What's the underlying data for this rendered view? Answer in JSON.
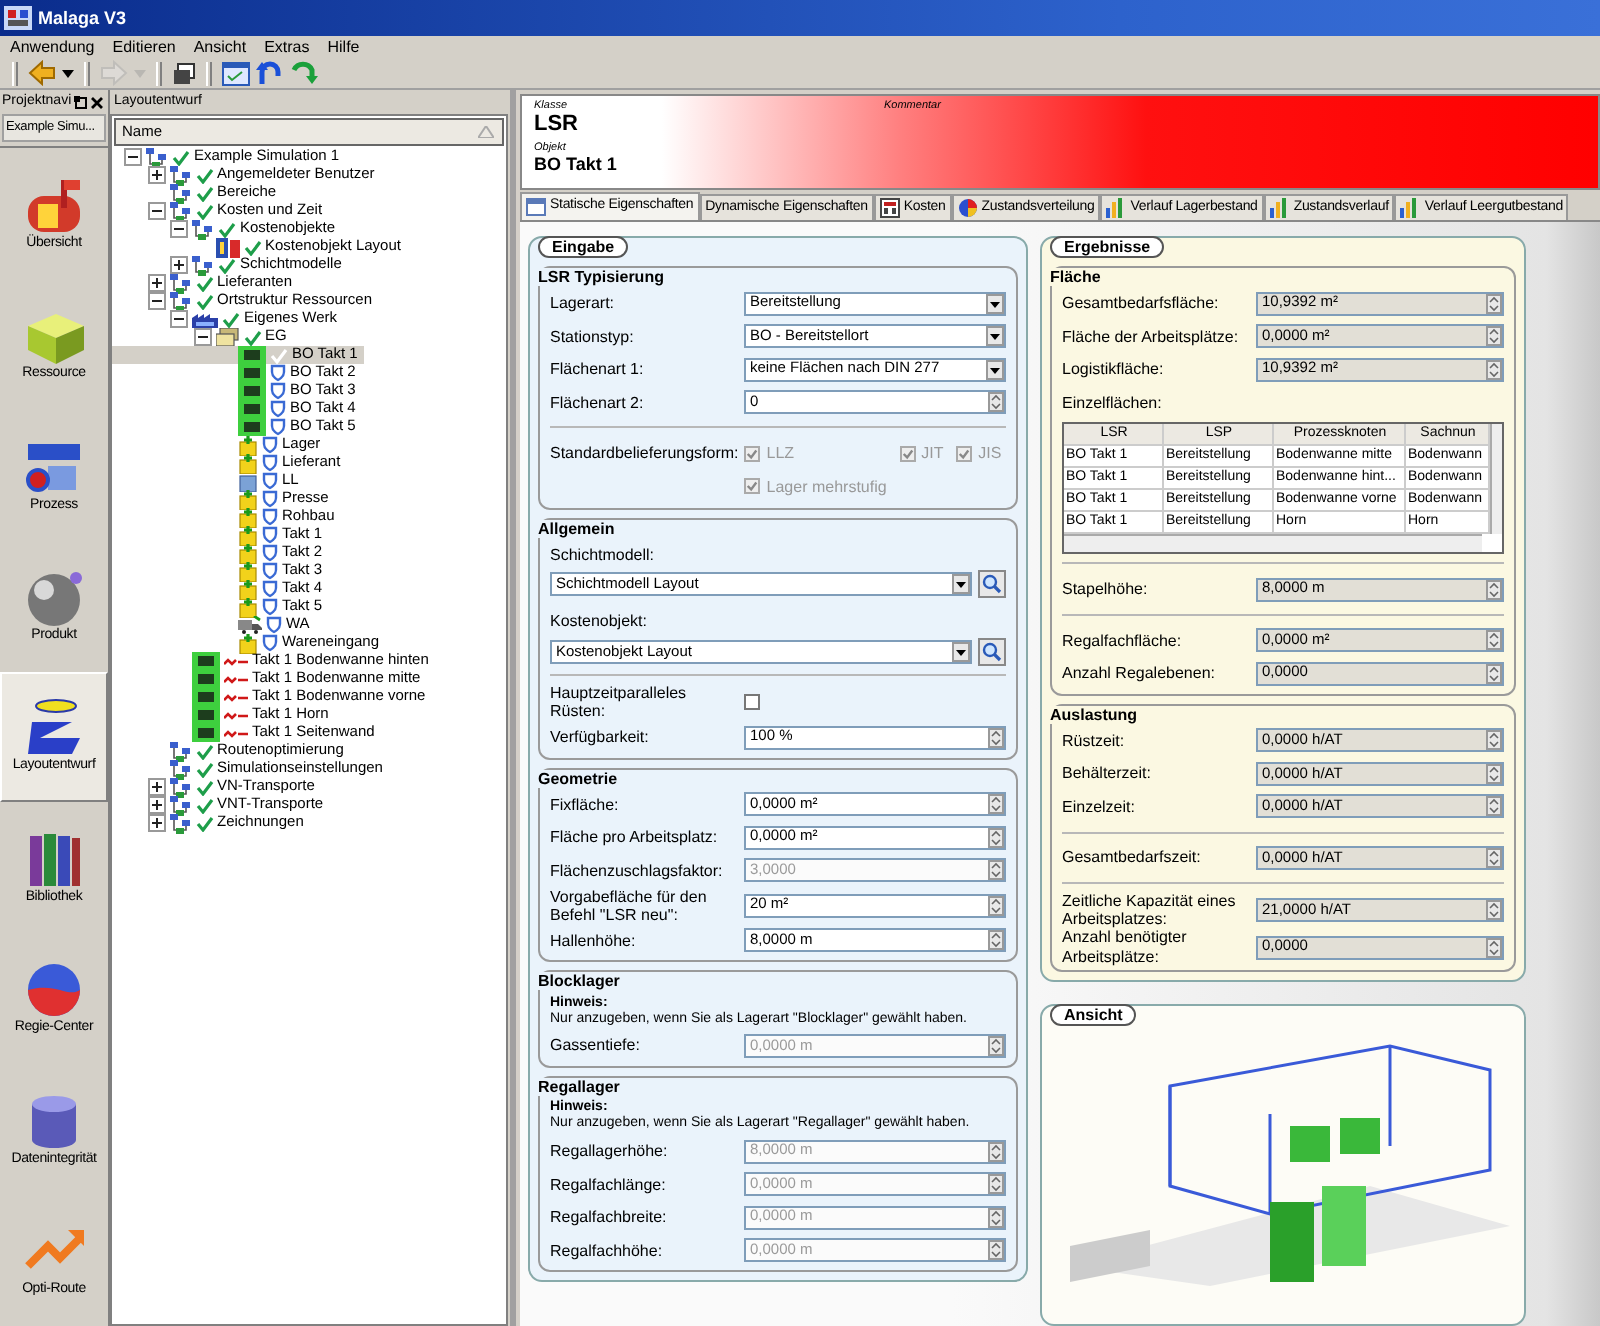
{
  "window": {
    "title": "Malaga V3"
  },
  "menu": [
    "Anwendung",
    "Editieren",
    "Ansicht",
    "Extras",
    "Hilfe"
  ],
  "toolbar": [
    {
      "kind": "back",
      "disabled": false
    },
    {
      "kind": "caret",
      "disabled": false
    },
    {
      "kind": "forward",
      "disabled": true
    },
    {
      "kind": "caret",
      "disabled": true
    },
    {
      "kind": "restore",
      "disabled": false
    },
    {
      "kind": "window",
      "disabled": false
    },
    {
      "kind": "undo",
      "disabled": false
    },
    {
      "kind": "redo",
      "disabled": false
    }
  ],
  "navigator": {
    "title": "Projektnavi",
    "project": "Example Simu...",
    "items": [
      {
        "label": "Übersicht",
        "kind": "mailbox",
        "selected": false
      },
      {
        "label": "Ressource",
        "kind": "cube",
        "selected": false
      },
      {
        "label": "Prozess",
        "kind": "process",
        "selected": false
      },
      {
        "label": "Produkt",
        "kind": "sphere",
        "selected": false
      },
      {
        "label": "Layoutentwurf",
        "kind": "layout",
        "selected": true
      },
      {
        "label": "Bibliothek",
        "kind": "books",
        "selected": false
      },
      {
        "label": "Regie-Center",
        "kind": "disc",
        "selected": false
      },
      {
        "label": "Datenintegrität",
        "kind": "cylinder",
        "selected": false
      },
      {
        "label": "Opti-Route",
        "kind": "route",
        "selected": false
      }
    ]
  },
  "tree": {
    "title": "Layoutentwurf",
    "column": "Name",
    "nodes": [
      {
        "label": "Example Simulation 1",
        "kind": "group",
        "checked": true,
        "error": false,
        "expanded": true,
        "selected": false,
        "children": [
          {
            "label": "Angemeldeter Benutzer",
            "kind": "group",
            "checked": true,
            "error": false,
            "expanded": false,
            "selected": false
          },
          {
            "label": "Bereiche",
            "kind": "group",
            "checked": true,
            "error": false,
            "selected": false
          },
          {
            "label": "Kosten und Zeit",
            "kind": "group",
            "checked": true,
            "error": false,
            "expanded": true,
            "selected": false,
            "children": [
              {
                "label": "Kostenobjekte",
                "kind": "group",
                "checked": true,
                "error": false,
                "expanded": true,
                "selected": false,
                "children": [
                  {
                    "label": "Kostenobjekt Layout",
                    "kind": "cost",
                    "checked": true,
                    "error": false,
                    "selected": false
                  }
                ]
              },
              {
                "label": "Schichtmodelle",
                "kind": "group",
                "checked": true,
                "error": false,
                "expanded": false,
                "selected": false
              }
            ]
          },
          {
            "label": "Lieferanten",
            "kind": "group",
            "checked": true,
            "error": false,
            "expanded": false,
            "selected": false
          },
          {
            "label": "Ortstruktur Ressourcen",
            "kind": "group",
            "checked": true,
            "error": false,
            "expanded": true,
            "selected": false,
            "children": [
              {
                "label": "Eigenes Werk",
                "kind": "plant",
                "checked": true,
                "error": false,
                "expanded": true,
                "selected": false,
                "children": [
                  {
                    "label": "EG",
                    "kind": "floor",
                    "checked": true,
                    "error": false,
                    "expanded": true,
                    "selected": false,
                    "children": [
                      {
                        "label": "BO Takt 1",
                        "kind": "station",
                        "checked": true,
                        "error": false,
                        "selected": true
                      },
                      {
                        "label": "BO Takt 2",
                        "kind": "station",
                        "checked": false,
                        "error": false,
                        "selected": false
                      },
                      {
                        "label": "BO Takt 3",
                        "kind": "station",
                        "checked": false,
                        "error": false,
                        "selected": false
                      },
                      {
                        "label": "BO Takt 4",
                        "kind": "station",
                        "checked": false,
                        "error": false,
                        "selected": false
                      },
                      {
                        "label": "BO Takt 5",
                        "kind": "station",
                        "checked": false,
                        "error": false,
                        "selected": false
                      },
                      {
                        "label": "Lager",
                        "kind": "storage",
                        "checked": false,
                        "error": false,
                        "selected": false
                      },
                      {
                        "label": "Lieferant",
                        "kind": "storage",
                        "checked": false,
                        "error": false,
                        "selected": false
                      },
                      {
                        "label": "LL",
                        "kind": "block",
                        "checked": false,
                        "error": false,
                        "selected": false
                      },
                      {
                        "label": "Presse",
                        "kind": "storage",
                        "checked": false,
                        "error": false,
                        "selected": false
                      },
                      {
                        "label": "Rohbau",
                        "kind": "storage",
                        "checked": false,
                        "error": false,
                        "selected": false
                      },
                      {
                        "label": "Takt 1",
                        "kind": "storage",
                        "checked": false,
                        "error": false,
                        "selected": false
                      },
                      {
                        "label": "Takt 2",
                        "kind": "storage",
                        "checked": false,
                        "error": false,
                        "selected": false
                      },
                      {
                        "label": "Takt 3",
                        "kind": "storage",
                        "checked": false,
                        "error": false,
                        "selected": false
                      },
                      {
                        "label": "Takt 4",
                        "kind": "storage",
                        "checked": false,
                        "error": false,
                        "selected": false
                      },
                      {
                        "label": "Takt 5",
                        "kind": "storage",
                        "checked": false,
                        "error": false,
                        "selected": false
                      },
                      {
                        "label": "WA",
                        "kind": "truck",
                        "checked": false,
                        "error": false,
                        "selected": false
                      },
                      {
                        "label": "Wareneingang",
                        "kind": "storage",
                        "checked": false,
                        "error": false,
                        "selected": false
                      }
                    ]
                  }
                ]
              },
              {
                "label": "Takt 1 Bodenwanne hinten",
                "kind": "station",
                "error": true,
                "selected": false
              },
              {
                "label": "Takt 1 Bodenwanne mitte",
                "kind": "station",
                "error": true,
                "selected": false
              },
              {
                "label": "Takt 1 Bodenwanne vorne",
                "kind": "station",
                "error": true,
                "selected": false
              },
              {
                "label": "Takt 1 Horn",
                "kind": "station",
                "error": true,
                "selected": false
              },
              {
                "label": "Takt 1 Seitenwand",
                "kind": "station",
                "error": true,
                "selected": false
              }
            ]
          },
          {
            "label": "Routenoptimierung",
            "kind": "group",
            "checked": true,
            "error": false,
            "selected": false
          },
          {
            "label": "Simulationseinstellungen",
            "kind": "group",
            "checked": true,
            "error": false,
            "selected": false
          },
          {
            "label": "VN-Transporte",
            "kind": "group",
            "checked": true,
            "error": false,
            "expanded": false,
            "selected": false
          },
          {
            "label": "VNT-Transporte",
            "kind": "group",
            "checked": true,
            "error": false,
            "expanded": false,
            "selected": false
          },
          {
            "label": "Zeichnungen",
            "kind": "group",
            "checked": true,
            "error": false,
            "expanded": false,
            "selected": false
          }
        ]
      }
    ]
  },
  "detail": {
    "class_label": "Klasse",
    "class": "LSR",
    "object_label": "Objekt",
    "object": "BO Takt 1",
    "comment_label": "Kommentar",
    "tabs": [
      {
        "label": "Statische Eigenschaften",
        "kind": "window",
        "selected": true
      },
      {
        "label": "Dynamische Eigenschaften",
        "kind": "plain",
        "selected": false
      },
      {
        "label": "Kosten",
        "kind": "calculator",
        "selected": false
      },
      {
        "label": "Zustandsverteilung",
        "kind": "pie",
        "selected": false
      },
      {
        "label": "Verlauf Lagerbestand",
        "kind": "bars",
        "selected": false
      },
      {
        "label": "Zustandsverlauf",
        "kind": "bars",
        "selected": false
      },
      {
        "label": "Verlauf Leergutbestand",
        "kind": "bars",
        "selected": false
      }
    ],
    "input": {
      "title": "Eingabe",
      "sections": [
        {
          "title": "LSR Typisierung",
          "rows": [
            {
              "kind": "select",
              "label": "Lagerart:",
              "value": "Bereitstellung",
              "disabled": false
            },
            {
              "kind": "select",
              "label": "Stationstyp:",
              "value": "BO - Bereitstellort",
              "disabled": false
            },
            {
              "kind": "select",
              "label": "Flächenart 1:",
              "value": "keine Flächen nach DIN 277",
              "disabled": false
            },
            {
              "kind": "spin",
              "label": "Flächenart 2:",
              "value": "0",
              "disabled": false
            },
            {
              "kind": "separator"
            },
            {
              "kind": "checks",
              "label": "Standardbelieferungsform:",
              "options": [
                {
                  "label": "LLZ",
                  "checked": true,
                  "disabled": true
                },
                {
                  "label": "JIT",
                  "checked": true,
                  "disabled": true
                },
                {
                  "label": "JIS",
                  "checked": true,
                  "disabled": true
                },
                {
                  "label": "Lager mehrstufig",
                  "checked": true,
                  "disabled": true
                }
              ]
            }
          ]
        },
        {
          "title": "Allgemein",
          "rows": [
            {
              "kind": "wide-select",
              "label": "Schichtmodell:",
              "value": "Schichtmodell Layout",
              "disabled": false
            },
            {
              "kind": "wide-select",
              "label": "Kostenobjekt:",
              "value": "Kostenobjekt Layout",
              "disabled": false
            },
            {
              "kind": "separator"
            },
            {
              "kind": "check",
              "label": "Hauptzeitparalleles Rüsten:",
              "checked": false,
              "disabled": false
            },
            {
              "kind": "spin",
              "label": "Verfügbarkeit:",
              "value": "100 %",
              "disabled": false
            }
          ]
        },
        {
          "title": "Geometrie",
          "rows": [
            {
              "kind": "spin",
              "label": "Fixfläche:",
              "value": "0,0000 m²",
              "disabled": false
            },
            {
              "kind": "spin",
              "label": "Fläche pro Arbeitsplatz:",
              "value": "0,0000 m²",
              "disabled": false
            },
            {
              "kind": "spin",
              "label": "Flächenzuschlagsfaktor:",
              "value": "3,0000",
              "disabled": true
            },
            {
              "kind": "spin",
              "label": "Vorgabefläche für den Befehl \"LSR neu\":",
              "value": "20 m²",
              "disabled": false
            },
            {
              "kind": "spin",
              "label": "Hallenhöhe:",
              "value": "8,0000 m",
              "disabled": false
            }
          ]
        },
        {
          "title": "Blocklager",
          "rows": [
            {
              "kind": "note",
              "title": "Hinweis:",
              "text": "Nur anzugeben, wenn Sie als Lagerart \"Blocklager\" gewählt haben."
            },
            {
              "kind": "spin",
              "label": "Gassentiefe:",
              "value": "0,0000 m",
              "disabled": true
            }
          ]
        },
        {
          "title": "Regallager",
          "rows": [
            {
              "kind": "note",
              "title": "Hinweis:",
              "text": "Nur anzugeben, wenn Sie als Lagerart \"Regallager\" gewählt haben."
            },
            {
              "kind": "spin",
              "label": "Regallagerhöhe:",
              "value": "8,0000 m",
              "disabled": true
            },
            {
              "kind": "spin",
              "label": "Regalfachlänge:",
              "value": "0,0000 m",
              "disabled": true
            },
            {
              "kind": "spin",
              "label": "Regalfachbreite:",
              "value": "0,0000 m",
              "disabled": true
            },
            {
              "kind": "spin",
              "label": "Regalfachhöhe:",
              "value": "0,0000 m",
              "disabled": true
            }
          ]
        }
      ]
    },
    "results": {
      "title": "Ergebnisse",
      "sections": [
        {
          "title": "Fläche",
          "rows": [
            {
              "kind": "spin",
              "label": "Gesamtbedarfsfläche:",
              "value": "10,9392 m²"
            },
            {
              "kind": "spin",
              "label": "Fläche der Arbeitsplätze:",
              "value": "0,0000 m²"
            },
            {
              "kind": "spin",
              "label": "Logistikfläche:",
              "value": "10,9392 m²"
            },
            {
              "kind": "table",
              "label": "Einzelflächen:",
              "columns": [
                "LSR",
                "LSP",
                "Prozessknoten",
                "Sachnun"
              ],
              "rows": [
                [
                  "BO Takt 1",
                  "Bereitstellung",
                  "Bodenwanne mitte",
                  "Bodenwann"
                ],
                [
                  "BO Takt 1",
                  "Bereitstellung",
                  "Bodenwanne hint...",
                  "Bodenwann"
                ],
                [
                  "BO Takt 1",
                  "Bereitstellung",
                  "Bodenwanne vorne",
                  "Bodenwann"
                ],
                [
                  "BO Takt 1",
                  "Bereitstellung",
                  "Horn",
                  "Horn"
                ]
              ]
            },
            {
              "kind": "separator"
            },
            {
              "kind": "spin",
              "label": "Stapelhöhe:",
              "value": "8,0000 m"
            },
            {
              "kind": "separator"
            },
            {
              "kind": "spin",
              "label": "Regalfachfläche:",
              "value": "0,0000 m²"
            },
            {
              "kind": "spin",
              "label": "Anzahl Regalebenen:",
              "value": "0,0000"
            }
          ]
        },
        {
          "title": "Auslastung",
          "rows": [
            {
              "kind": "spin",
              "label": "Rüstzeit:",
              "value": "0,0000 h/AT"
            },
            {
              "kind": "spin",
              "label": "Behälterzeit:",
              "value": "0,0000 h/AT"
            },
            {
              "kind": "spin",
              "label": "Einzelzeit:",
              "value": "0,0000 h/AT"
            },
            {
              "kind": "separator"
            },
            {
              "kind": "spin",
              "label": "Gesamtbedarfszeit:",
              "value": "0,0000 h/AT"
            },
            {
              "kind": "separator"
            },
            {
              "kind": "spin",
              "label": "Zeitliche Kapazität eines Arbeitsplatzes:",
              "value": "21,0000 h/AT"
            },
            {
              "kind": "spin",
              "label": "Anzahl benötigter Arbeitsplätze:",
              "value": "0,0000"
            }
          ]
        }
      ]
    },
    "view": {
      "title": "Ansicht"
    }
  }
}
